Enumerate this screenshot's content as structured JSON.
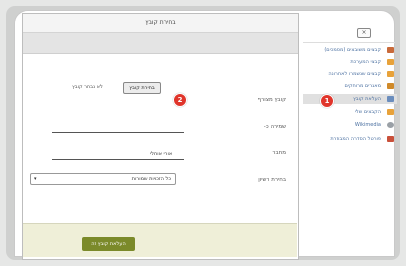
{
  "dialog": {
    "title": "בחירת קובץ",
    "file_label": "קובץ מצורף",
    "choose_button": "בחירת קובץ",
    "no_file_text": "לא נבחר קובץ",
    "save_as_label": "שמירה כ-",
    "save_as_value": "",
    "author_label": "מחבר",
    "author_value": "אורי אוחלי",
    "license_label": "בחירת רשיון",
    "license_value": "כל הזכויות שמורות",
    "upload_button": "העלאת קובץ זה"
  },
  "badges": {
    "one": "1",
    "two": "2"
  },
  "sidebar": {
    "close_label": "×",
    "items": [
      {
        "label": "קבצים משובצים (מסמכים)",
        "icon": "document-icon",
        "color": "#c96a3a"
      },
      {
        "label": "קבצי המערכת",
        "icon": "folder-icon",
        "color": "#e8a23a"
      },
      {
        "label": "קבצים שנשמרו לאחרונה",
        "icon": "folder-icon",
        "color": "#e8a23a"
      },
      {
        "label": "מאגרים מרוחקים",
        "icon": "repository-icon",
        "color": "#d08a2a"
      },
      {
        "label": "העלאת קובץ",
        "icon": "upload-icon",
        "color": "#6a8dbd"
      },
      {
        "label": "הקבצים שלי",
        "icon": "folder-icon",
        "color": "#e8a23a"
      },
      {
        "label": "Wikimedia",
        "icon": "wikimedia-icon",
        "color": "#9aa0a6"
      },
      {
        "label": "פורטל הסדרה המבוזרת",
        "icon": "portal-icon",
        "color": "#c9503a"
      }
    ]
  }
}
